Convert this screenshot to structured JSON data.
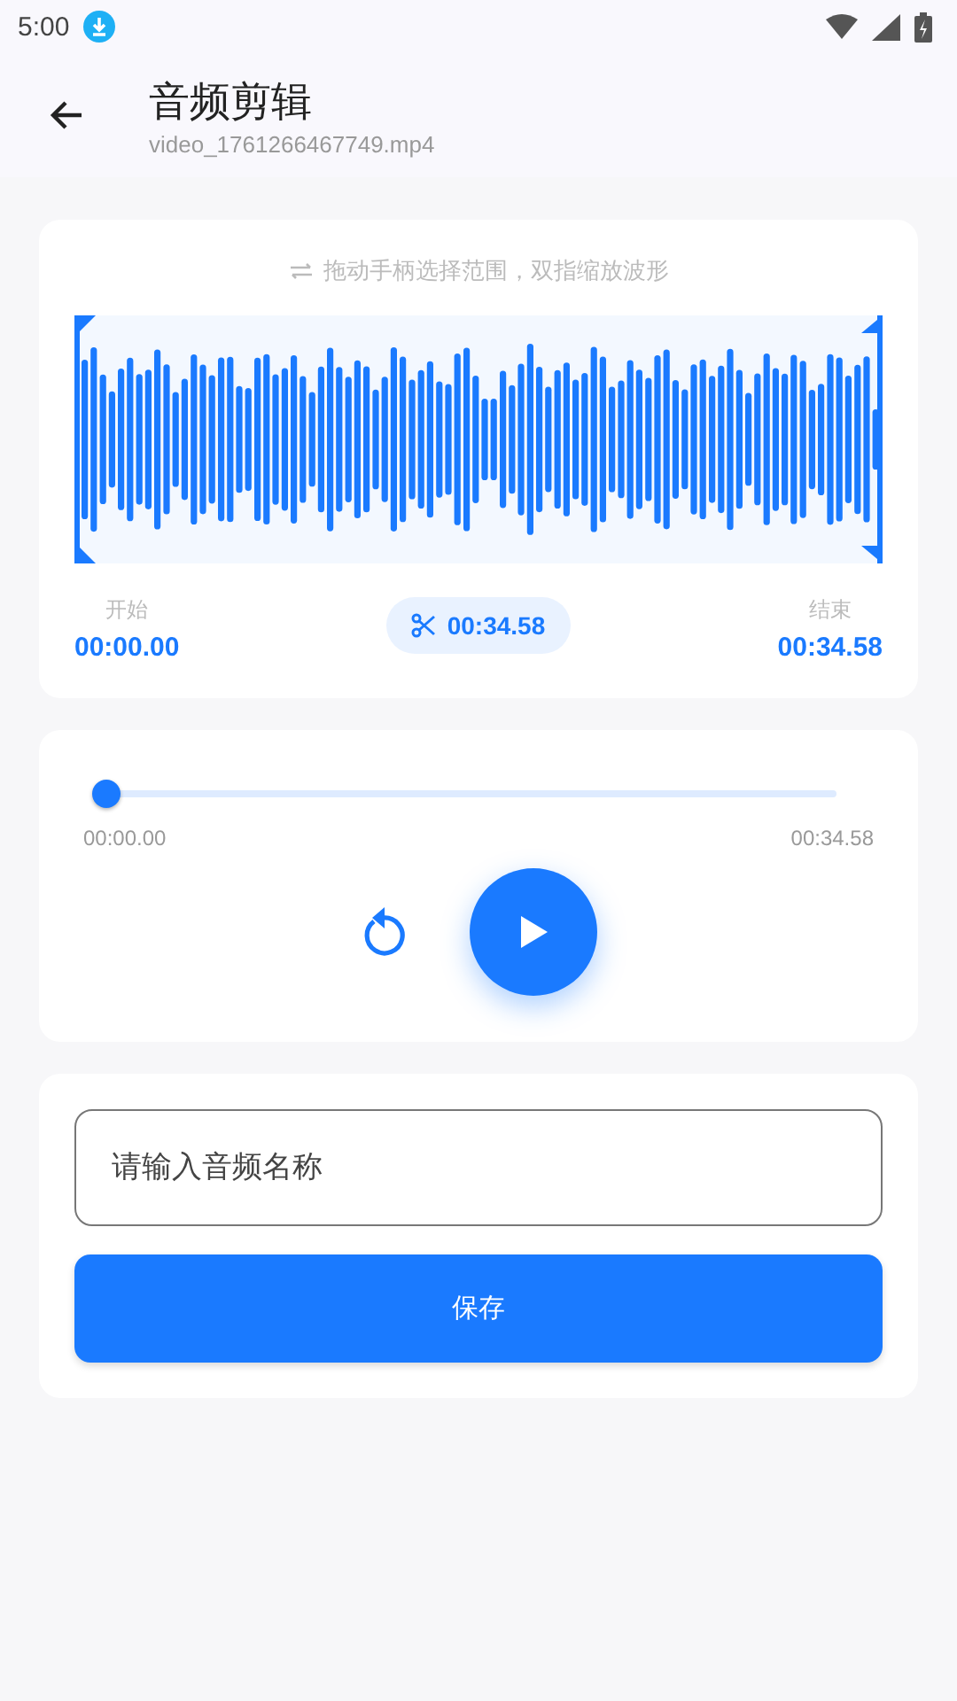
{
  "status_bar": {
    "time": "5:00"
  },
  "header": {
    "title": "音频剪辑",
    "subtitle": "video_1761266467749.mp4"
  },
  "trim": {
    "hint": "拖动手柄选择范围，双指缩放波形",
    "start_label": "开始",
    "start_time": "00:00.00",
    "duration": "00:34.58",
    "end_label": "结束",
    "end_time": "00:34.58"
  },
  "player": {
    "level": 0,
    "current": "00:00.00",
    "total": "00:34.58",
    "playing": false
  },
  "save": {
    "placeholder": "请输入音频名称",
    "button": "保存"
  }
}
